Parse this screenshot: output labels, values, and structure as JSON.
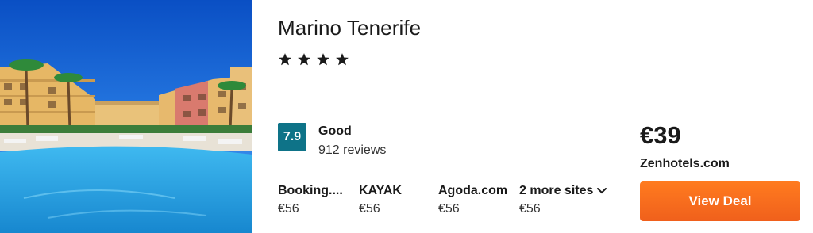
{
  "hotel": {
    "name": "Marino Tenerife",
    "star_count": 4,
    "star_icon": "star-icon"
  },
  "rating": {
    "score": "7.9",
    "label": "Good",
    "reviews": "912 reviews",
    "badge_color": "#0e7388"
  },
  "offers": [
    {
      "site": "Booking....",
      "price": "€56"
    },
    {
      "site": "KAYAK",
      "price": "€56"
    },
    {
      "site": "Agoda.com",
      "price": "€56"
    },
    {
      "site": "2 more sites",
      "price": "€56",
      "icon": "chevron-down-icon"
    }
  ],
  "deal": {
    "price": "€39",
    "provider": "Zenhotels.com",
    "button_label": "View Deal",
    "button_color": "#f26b1d"
  }
}
